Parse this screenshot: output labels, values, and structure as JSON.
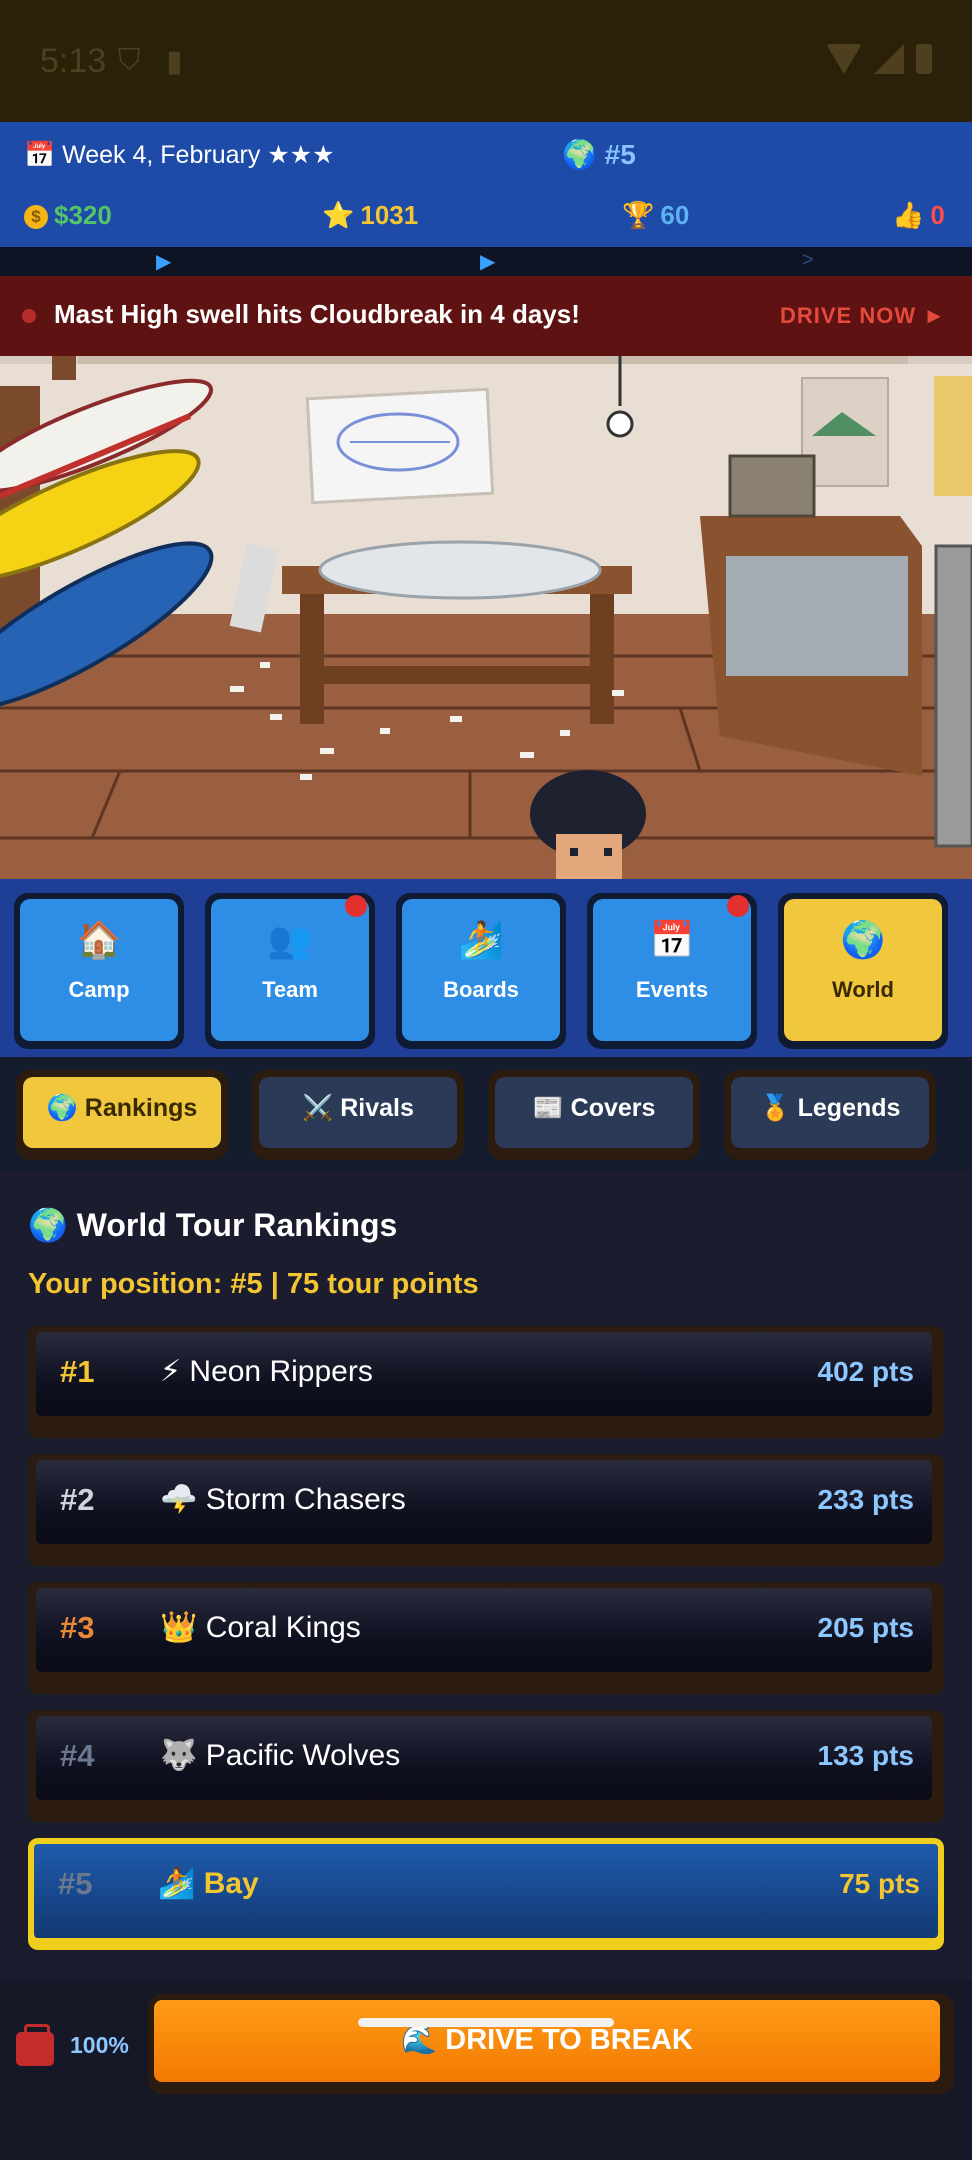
{
  "status_bar": {
    "time": "5:13",
    "icons": [
      "shield-icon",
      "sim-card-icon",
      "wifi-icon",
      "cellular-icon",
      "battery-icon"
    ]
  },
  "top_bar": {
    "date": "Week 4, February ★★★",
    "rank": "#5",
    "money": "$320",
    "stars": "1031",
    "gems": "60",
    "fans": "0"
  },
  "banner": {
    "message": "Mast High swell hits Cloudbreak in 4 days!",
    "cta": "DRIVE NOW ►"
  },
  "nav": {
    "items": [
      {
        "label": "Camp",
        "icon": "🏠"
      },
      {
        "label": "Team",
        "icon": "👥"
      },
      {
        "label": "Boards",
        "icon": "🏄"
      },
      {
        "label": "Events",
        "icon": "📅"
      },
      {
        "label": "World",
        "icon": "🌍"
      }
    ],
    "active": "World"
  },
  "subtabs": {
    "items": [
      {
        "label": "🌍 Rankings"
      },
      {
        "label": "⚔️ Rivals"
      },
      {
        "label": "📰 Covers"
      },
      {
        "label": "🏅 Legends"
      }
    ],
    "active": "Rankings"
  },
  "rankings": {
    "title": "🌍 World Tour Rankings",
    "position": "Your position: #5 | 75 tour points",
    "rows": [
      {
        "rank": "#1",
        "team": "⚡ Neon Rippers",
        "points": "402 pts",
        "rank_color": "#f3c532"
      },
      {
        "rank": "#2",
        "team": "🌩️ Storm Chasers",
        "points": "233 pts",
        "rank_color": "#cfd3dc"
      },
      {
        "rank": "#3",
        "team": "👑 Coral Kings",
        "points": "205 pts",
        "rank_color": "#e8893a"
      },
      {
        "rank": "#4",
        "team": "🐺 Pacific Wolves",
        "points": "133 pts",
        "rank_color": "#6b7890"
      },
      {
        "rank": "#5",
        "team": "🏄 Bay",
        "points": "75 pts",
        "rank_color": "#6b7890"
      }
    ]
  },
  "bottom": {
    "fuel": "100%",
    "drive_label": "🌊 DRIVE TO BREAK"
  }
}
